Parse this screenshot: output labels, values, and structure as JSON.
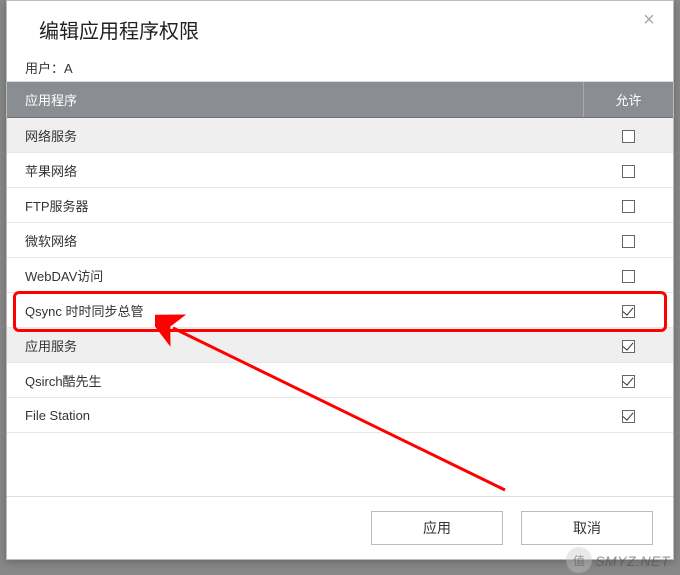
{
  "dialog": {
    "title": "编辑应用程序权限",
    "user_label": "用户：",
    "user_value": "A"
  },
  "table": {
    "header_app": "应用程序",
    "header_allow": "允许",
    "rows": [
      {
        "label": "网络服务",
        "group": true,
        "checked": false
      },
      {
        "label": "苹果网络",
        "group": false,
        "checked": false
      },
      {
        "label": "FTP服务器",
        "group": false,
        "checked": false
      },
      {
        "label": "微软网络",
        "group": false,
        "checked": false
      },
      {
        "label": "WebDAV访问",
        "group": false,
        "checked": false
      },
      {
        "label": "Qsync 时时同步总管",
        "group": false,
        "checked": true
      },
      {
        "label": "应用服务",
        "group": true,
        "checked": true
      },
      {
        "label": "Qsirch酷先生",
        "group": false,
        "checked": true
      },
      {
        "label": "File Station",
        "group": false,
        "checked": true
      }
    ]
  },
  "footer": {
    "apply": "应用",
    "cancel": "取消"
  },
  "annotation": {
    "highlight_color": "#ff0000"
  },
  "watermark": {
    "text": "SMYZ.NET",
    "badge": "值"
  }
}
